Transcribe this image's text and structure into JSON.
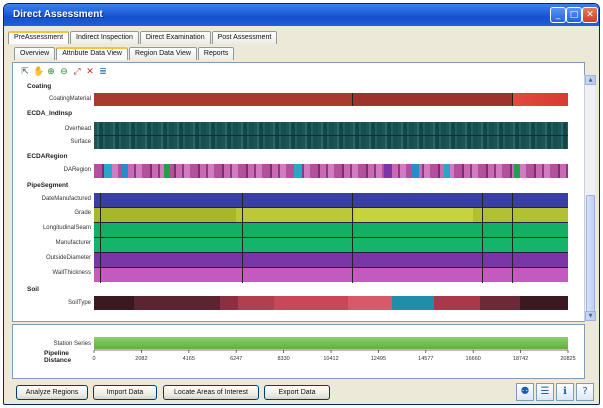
{
  "window": {
    "title": "Direct Assessment"
  },
  "main_tabs": [
    "PreAssessment",
    "Indirect Inspection",
    "Direct Examination",
    "Post Assessment"
  ],
  "sub_tabs": [
    "Overview",
    "Attribute Data View",
    "Region Data View",
    "Reports"
  ],
  "groups": {
    "coating": "Coating",
    "ecda_indirect": "ECDA_IndInsp",
    "ecda_region": "ECDARegion",
    "pipe_segment": "PipeSegment",
    "soil": "Soil"
  },
  "rows": {
    "coating_material": "CoatingMaterial",
    "overhead": "Overhead",
    "surface": "Surface",
    "da_region": "DARegion",
    "date_manufactured": "DateManufactured",
    "grade": "Grade",
    "longitudinal_seam": "LongitudinalSeam",
    "manufacturer": "Manufacturer",
    "outside_diameter": "OutsideDiameter",
    "wall_thickness": "WallThickness",
    "soil_type": "SoilType"
  },
  "station_labels": {
    "station": "Station Series",
    "pipeline": "Pipeline",
    "distance": "Distance"
  },
  "axis_ticks": [
    "0",
    "2082",
    "4165",
    "6247",
    "8330",
    "10412",
    "12495",
    "14577",
    "16660",
    "18742",
    "20825"
  ],
  "buttons": {
    "analyze": "Analyze Regions",
    "import": "Import Data",
    "locate": "Locate Areas of Interest",
    "export": "Export Data"
  },
  "colors": {
    "coating": "#a83a30",
    "teal": "#1f5a5a",
    "region_magenta": "#b44f9e",
    "pipe_blue": "#3a3fa6",
    "pipe_yellow": "#b8c332",
    "pipe_green": "#12b065",
    "pipe_purple": "#7a36a6",
    "pipe_pink": "#c45ac0",
    "soil_dark": "#5a2530",
    "station_green": "#6fbb52"
  }
}
